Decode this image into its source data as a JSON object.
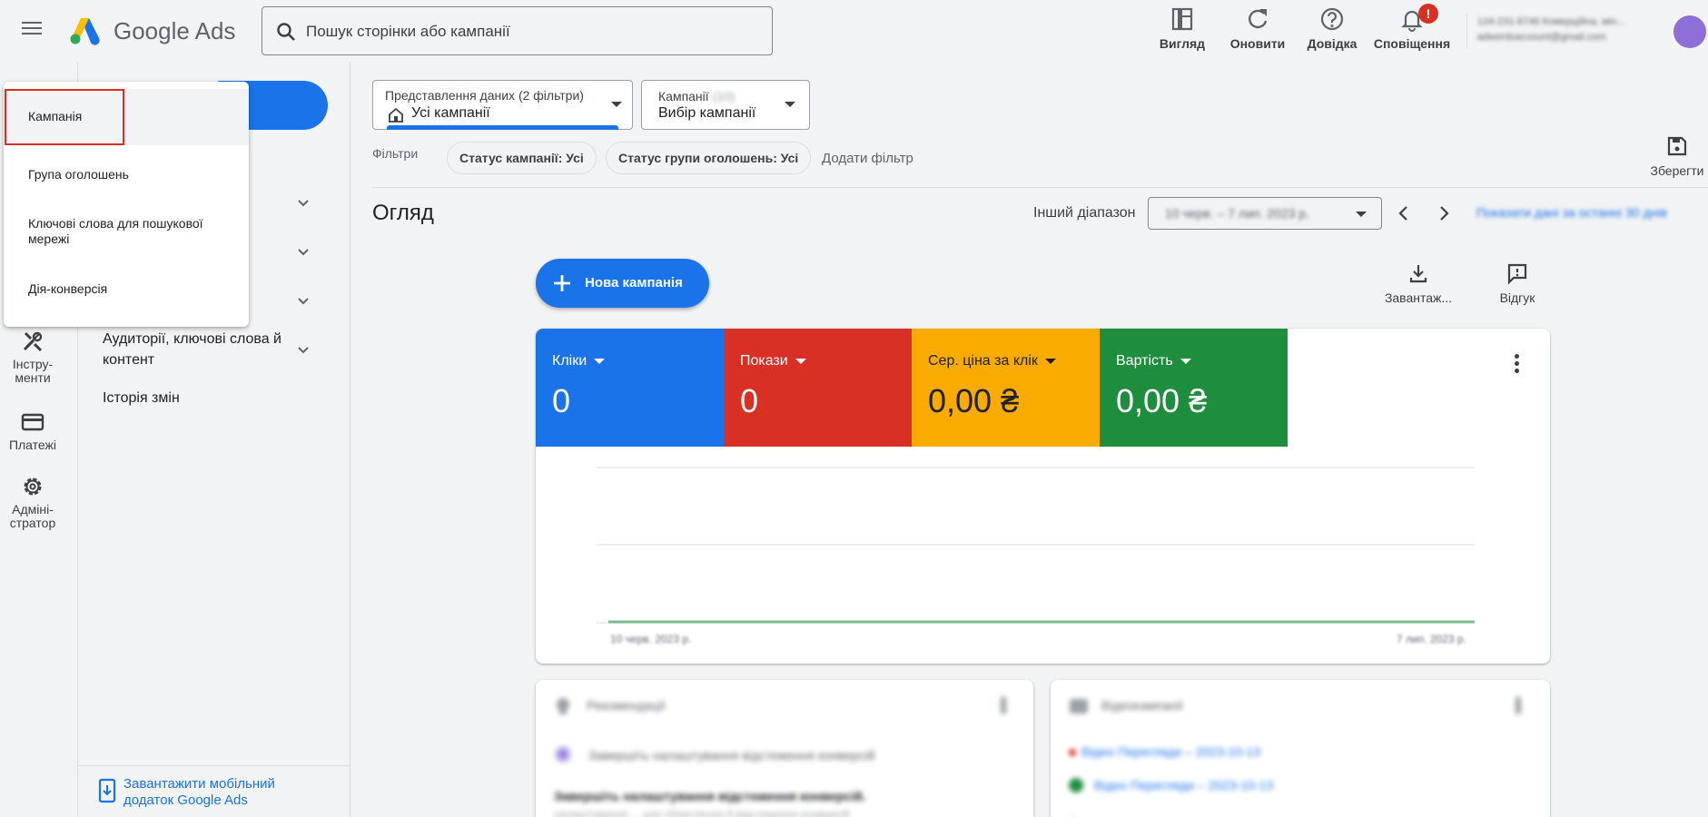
{
  "header": {
    "logo_text": "Google Ads",
    "search_placeholder": "Пошук сторінки або кампанії",
    "actions": {
      "view": "Вигляд",
      "refresh": "Оновити",
      "help": "Довідка",
      "notifications": "Сповіщення"
    },
    "notification_badge": "!",
    "account_line1": "134-231-8746 Комерційна, мін...",
    "account_line2": "adwordsaccount@gmail.com"
  },
  "rail": {
    "tools": "Інстру-\nменти",
    "payments": "Платежі",
    "admin": "Адміні-\nстратор"
  },
  "nav": {
    "items": [
      "Аудиторії, ключові слова й контент",
      "Історія змін"
    ],
    "mobile_link": "Завантажити мобільний додаток Google Ads"
  },
  "dropdown": {
    "items": [
      "Кампанія",
      "Група оголошень",
      "Ключові слова для пошукової мережі",
      "Дія-конверсія"
    ]
  },
  "data_view": {
    "label": "Представлення даних (2 фільтри)",
    "value": "Усі кампанії"
  },
  "campaign_selector": {
    "label": "Кампанії",
    "count": "(10)",
    "value": "Вибір кампанії"
  },
  "filters": {
    "label": "Фільтри",
    "chips": [
      "Статус кампанії: Усі",
      "Статус групи оголошень: Усі"
    ],
    "add_filter": "Додати фільтр",
    "save": "Зберегти"
  },
  "overview": {
    "title": "Огляд",
    "range_label": "Інший діапазон",
    "date_range": "10 черв. – 7 лип. 2023 р.",
    "compare_link": "Показати дані за останні 30 днів"
  },
  "actions": {
    "new_campaign": "Нова кампанія",
    "download": "Завантаж...",
    "feedback": "Відгук"
  },
  "metrics": [
    {
      "name": "Кліки",
      "value": "0",
      "color": "#1a73e8"
    },
    {
      "name": "Покази",
      "value": "0",
      "color": "#d93025"
    },
    {
      "name": "Сер. ціна за клік",
      "value": "0,00 ₴",
      "color": "#f9ab00"
    },
    {
      "name": "Вартість",
      "value": "0,00 ₴",
      "color": "#1e8e3e"
    }
  ],
  "chart_axis": {
    "start": "10 черв. 2023 р.",
    "end": "7 лип. 2023 р."
  },
  "cards": {
    "recommendations": {
      "title": "Рекомендації",
      "line1": "Завершіть налаштування відстеження конверсій",
      "line2": "Завершіть налаштування відстеження конверсій.",
      "line3": "налаштування ... для обчислення й відстеження конверсій"
    },
    "campaigns": {
      "title": "Відеокампанії",
      "line1": "Відео Перегляди – 2023-10-13",
      "line2": "Відео Перегляди – 2023-10-13",
      "line3": "..."
    }
  }
}
